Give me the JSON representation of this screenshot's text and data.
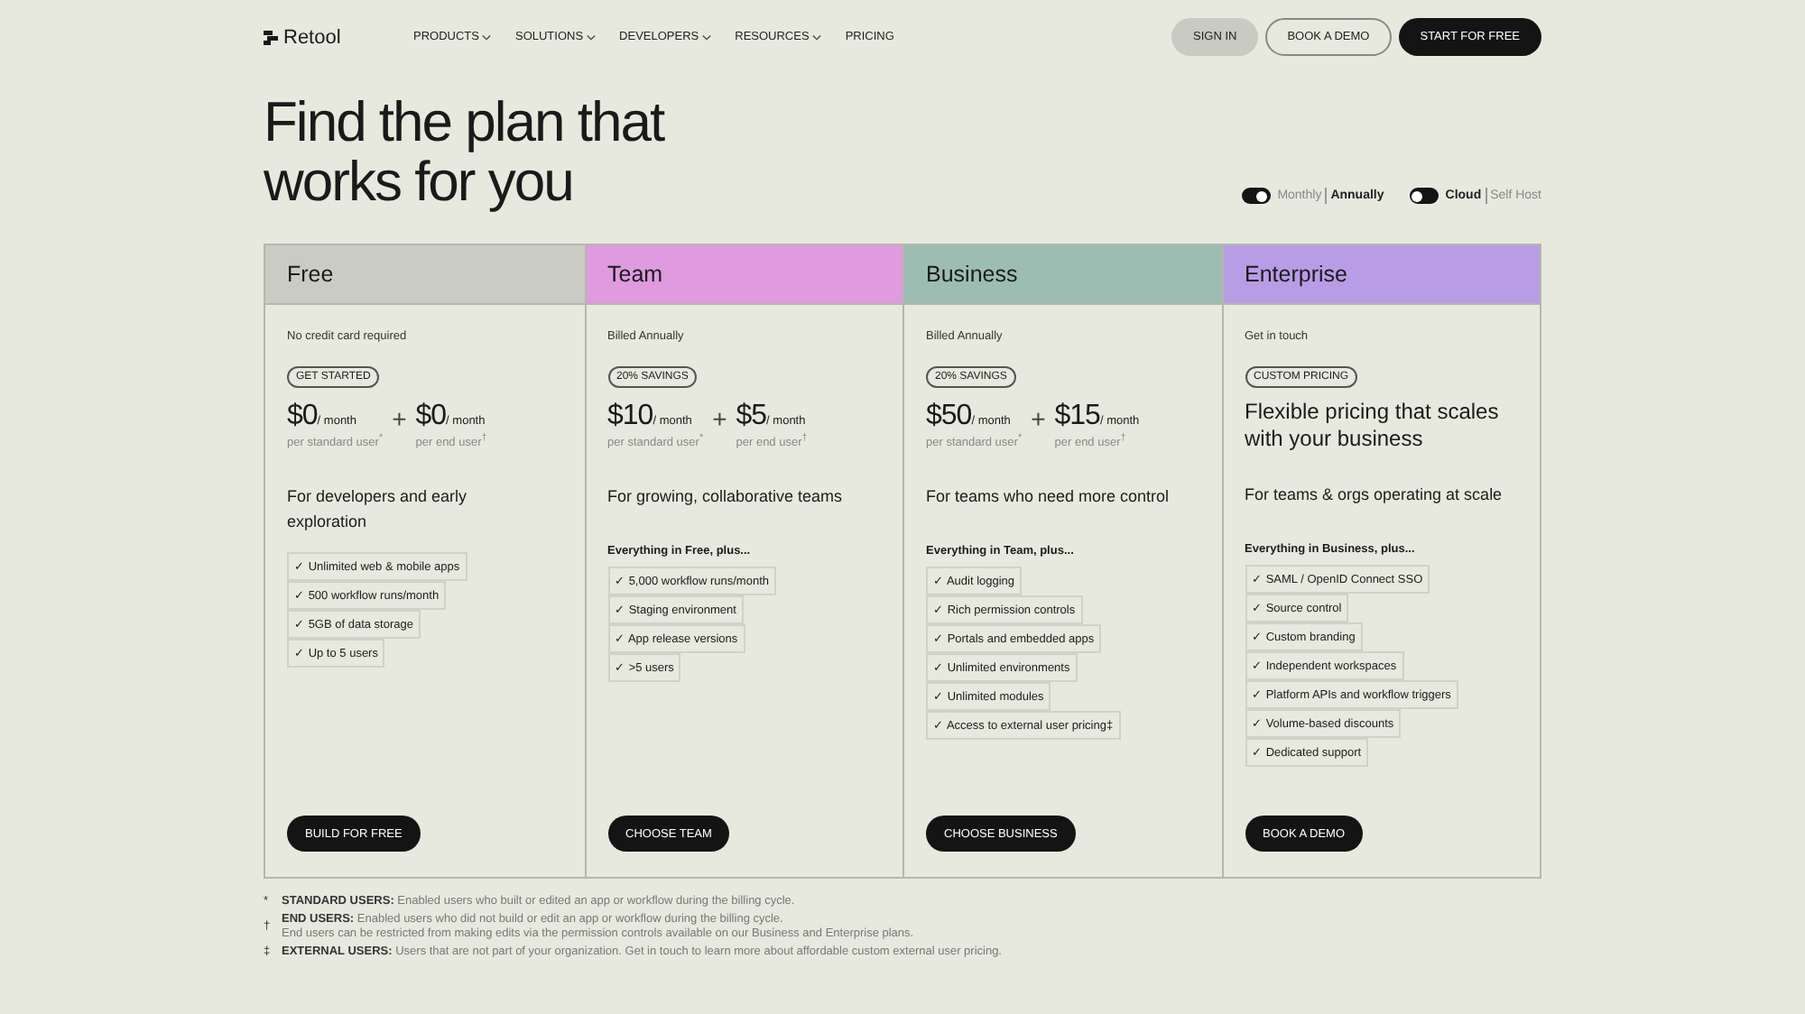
{
  "nav": {
    "logo": "Retool",
    "links": [
      {
        "label": "PRODUCTS",
        "dropdown": true
      },
      {
        "label": "SOLUTIONS",
        "dropdown": true
      },
      {
        "label": "DEVELOPERS",
        "dropdown": true
      },
      {
        "label": "RESOURCES",
        "dropdown": true
      },
      {
        "label": "PRICING",
        "dropdown": false
      }
    ],
    "buttons": [
      {
        "label": "SIGN IN",
        "kind": "muted"
      },
      {
        "label": "BOOK A DEMO",
        "kind": "outline"
      },
      {
        "label": "START FOR FREE",
        "kind": "dark"
      }
    ]
  },
  "heading": [
    "Find the plan that",
    "works for you"
  ],
  "toggles": [
    {
      "options": [
        {
          "label": "Monthly",
          "selected": false
        },
        {
          "label": "Annually",
          "selected": true
        }
      ]
    },
    {
      "options": [
        {
          "label": "Cloud",
          "selected": true
        },
        {
          "label": "Self Host",
          "selected": false
        }
      ]
    }
  ],
  "plans": [
    {
      "name": "Free",
      "color": "#cacbc3",
      "note": "No credit card required",
      "badge": "GET STARTED",
      "kind": "prices",
      "prices": [
        {
          "amount": "$0",
          "unit": "/ month",
          "caption": "per standard user$^{*}$"
        },
        {
          "amount": "$0",
          "unit": "/ month",
          "caption": "per end user$^{†}$"
        }
      ],
      "description": "For developers and early exploration",
      "features": [
        "Unlimited web & mobile apps",
        "500 workflow runs/month",
        "5GB of data storage",
        "Up to 5 users"
      ],
      "cta": "BUILD FOR FREE"
    },
    {
      "name": "Team",
      "color": "#df9ae0",
      "note": "Billed Annually",
      "badge": "20% SAVINGS",
      "kind": "prices",
      "prices": [
        {
          "amount": "$10",
          "unit": "/ month",
          "caption": "per standard user$^{*}$"
        },
        {
          "amount": "$5",
          "unit": "/ month",
          "caption": "per end user$^{†}$"
        }
      ],
      "description": "For growing, collaborative teams",
      "features_heading": "Everything in Free, plus...",
      "features": [
        "5,000 workflow runs/month",
        "Staging environment",
        "App release versions",
        ">5 users"
      ],
      "cta": "CHOOSE TEAM"
    },
    {
      "name": "Business",
      "color": "#9dbdb3",
      "note": "Billed Annually",
      "badge": "20% SAVINGS",
      "kind": "prices",
      "prices": [
        {
          "amount": "$50",
          "unit": "/ month",
          "caption": "per standard user$^{*}$"
        },
        {
          "amount": "$15",
          "unit": "/ month",
          "caption": "per end user$^{†}$"
        }
      ],
      "description": "For teams who need more control",
      "features_heading": "Everything in Team, plus...",
      "features": [
        "Audit logging",
        "Rich permission controls",
        "Portals and embedded apps",
        "Unlimited environments",
        "Unlimited modules",
        "Access to external user pricing‡"
      ],
      "cta": "CHOOSE BUSINESS"
    },
    {
      "name": "Enterprise",
      "color": "#b89ce6",
      "note": "Get in touch",
      "badge": "CUSTOM PRICING",
      "kind": "tagline",
      "tagline": "Flexible pricing that scales with your business",
      "description": "For teams & orgs operating at scale",
      "features_heading": "Everything in Business, plus...",
      "features": [
        "SAML / OpenID Connect SSO",
        "Source control",
        "Custom branding",
        "Independent workspaces",
        "Platform APIs and workflow triggers",
        "Volume-based discounts",
        "Dedicated support"
      ],
      "cta": "BOOK A DEMO"
    }
  ],
  "footnotes": [
    {
      "mark": "*",
      "label": "STANDARD USERS:",
      "lines": [
        "Enabled users who built or edited an app or workflow during the billing cycle."
      ]
    },
    {
      "mark": "†",
      "label": "END USERS:",
      "lines": [
        "Enabled users who did not build or edit an app or workflow during the billing cycle.",
        "End users can be restricted from making edits via the permission controls available on our Business and Enterprise plans."
      ]
    },
    {
      "mark": "‡",
      "label": "EXTERNAL USERS:",
      "lines": [
        "Users that are not part of your organization. Get in touch to learn more about affordable custom external user pricing."
      ]
    }
  ],
  "check": "✓",
  "plus": "+"
}
